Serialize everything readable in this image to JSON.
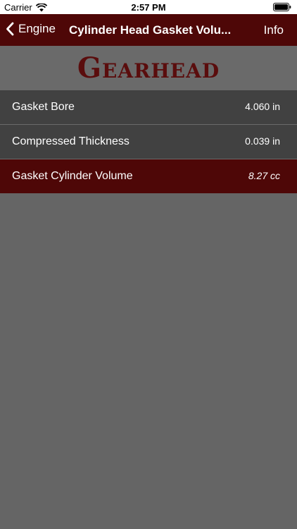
{
  "status_bar": {
    "carrier": "Carrier",
    "time": "2:57 PM",
    "wifi_icon": "wifi-icon",
    "battery_icon": "battery-icon"
  },
  "nav": {
    "back_label": "Engine",
    "title": "Cylinder Head Gasket Volu...",
    "info_label": "Info"
  },
  "logo": {
    "text": "Gearhead",
    "color": "#5a0d0d"
  },
  "rows": [
    {
      "label": "Gasket Bore",
      "value": "4.060 in"
    },
    {
      "label": "Compressed Thickness",
      "value": "0.039 in"
    },
    {
      "label": "Gasket Cylinder Volume",
      "value": "8.27 cc"
    }
  ],
  "colors": {
    "accent": "#4e0707",
    "row_bg": "#414141",
    "page_bg": "#656565"
  }
}
